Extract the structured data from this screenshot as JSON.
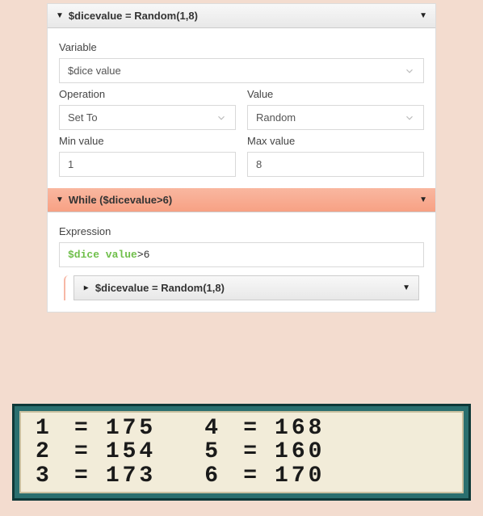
{
  "block1": {
    "title": "$dicevalue = Random(1,8)",
    "variable_label": "Variable",
    "variable_value": "$dice value",
    "operation_label": "Operation",
    "operation_value": "Set To",
    "value_label": "Value",
    "value_value": "Random",
    "min_label": "Min value",
    "min_value": "1",
    "max_label": "Max value",
    "max_value": "8"
  },
  "block2": {
    "title": "While ($dicevalue>6)",
    "expression_label": "Expression",
    "expr_var": "$dice value",
    "expr_rest": ">6",
    "nested_title": "$dicevalue = Random(1,8)"
  },
  "counter": {
    "rows": [
      {
        "left_k": "1",
        "left_v": "175",
        "right_k": "4",
        "right_v": "168"
      },
      {
        "left_k": "2",
        "left_v": "154",
        "right_k": "5",
        "right_v": "160"
      },
      {
        "left_k": "3",
        "left_v": "173",
        "right_k": "6",
        "right_v": "170"
      }
    ]
  }
}
